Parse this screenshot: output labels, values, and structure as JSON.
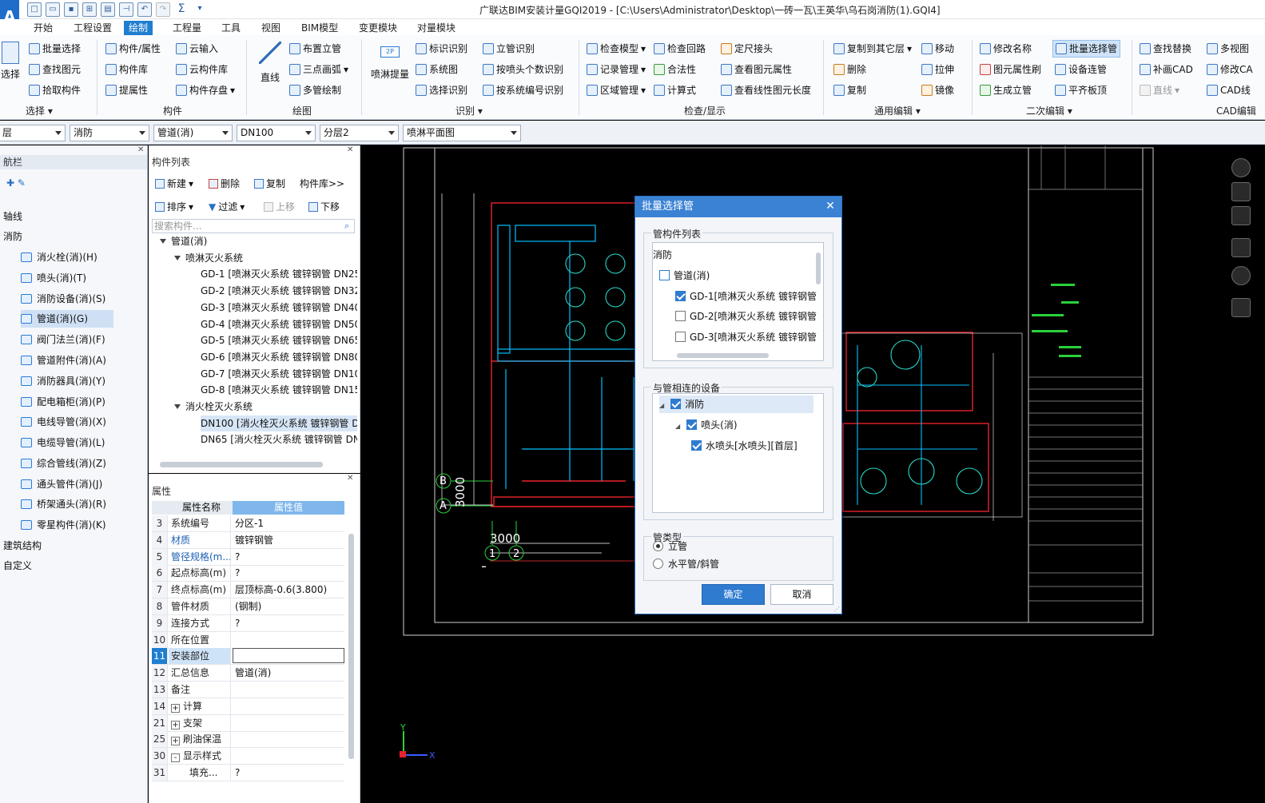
{
  "window": {
    "title": "广联达BIM安装计量GQI2019 - [C:\\Users\\Administrator\\Desktop\\一砖一瓦\\王英华\\乌石岗消防(1).GQI4]",
    "app_icon_letter": "A"
  },
  "quick_access": [
    "new-icon",
    "open-icon",
    "save-icon",
    "export-icon",
    "print-icon",
    "pin-icon",
    "undo-icon",
    "redo-icon",
    "sum-icon",
    "more-icon"
  ],
  "menu": [
    "开始",
    "工程设置",
    "绘制",
    "工程量",
    "工具",
    "视图",
    "BIM模型",
    "变更模块",
    "对量模块"
  ],
  "menu_active": "绘制",
  "ribbon": {
    "select": {
      "big_label": "选择",
      "items": [
        "批量选择",
        "查找图元",
        "拾取构件"
      ],
      "group": "选择"
    },
    "component": {
      "items": [
        "构件/属性",
        "构件库",
        "提属性",
        "云输入",
        "云构件库",
        "构件存盘"
      ],
      "group": "构件"
    },
    "draw": {
      "big_label": "直线",
      "items": [
        "布置立管",
        "三点画弧",
        "多管绘制"
      ],
      "group": "绘图"
    },
    "recognize": {
      "big_label": "喷淋提量",
      "items": [
        "标识识别",
        "系统图",
        "选择识别",
        "立管识别",
        "按喷头个数识别",
        "按系统编号识别"
      ],
      "group": "识别"
    },
    "check": {
      "items": [
        "检查模型",
        "记录管理",
        "区域管理",
        "检查回路",
        "合法性",
        "计算式",
        "定尺接头",
        "查看图元属性",
        "查看线性图元长度"
      ],
      "group": "检查/显示"
    },
    "edit": {
      "items": [
        "复制到其它层",
        "删除",
        "复制",
        "移动",
        "拉伸",
        "镜像"
      ],
      "group": "通用编辑"
    },
    "secondary": {
      "items": [
        "修改名称",
        "图元属性刷",
        "生成立管",
        "批量选择管",
        "设备连管",
        "平齐板顶"
      ],
      "group": "二次编辑"
    },
    "cad": {
      "items": [
        "查找替换",
        "补画CAD",
        "直线",
        "多视图",
        "修改CA",
        "CAD线"
      ],
      "group": "CAD编辑"
    }
  },
  "dropdowns": [
    "层",
    "消防",
    "管道(消)",
    "DN100",
    "分层2",
    "喷淋平面图"
  ],
  "nav": {
    "title": "航栏",
    "items": [
      "轴线",
      "消防",
      "消火栓(消)(H)",
      "喷头(消)(T)",
      "消防设备(消)(S)",
      "管道(消)(G)",
      "阀门法兰(消)(F)",
      "管道附件(消)(A)",
      "消防器具(消)(Y)",
      "配电箱柜(消)(P)",
      "电线导管(消)(X)",
      "电缆导管(消)(L)",
      "综合管线(消)(Z)",
      "通头管件(消)(J)",
      "桥架通头(消)(R)",
      "零星构件(消)(K)",
      "建筑结构",
      "自定义"
    ],
    "selected": "管道(消)(G)"
  },
  "component_list": {
    "title": "构件列表",
    "toolbar": [
      "新建",
      "删除",
      "复制",
      "构件库>>",
      "排序",
      "过滤",
      "上移",
      "下移"
    ],
    "search_placeholder": "搜索构件...",
    "tree": [
      {
        "label": "管道(消)",
        "level": 0
      },
      {
        "label": "喷淋灭火系统",
        "level": 1
      },
      {
        "label": "GD-1 [喷淋灭火系统 镀锌钢管 DN25",
        "level": 2
      },
      {
        "label": "GD-2 [喷淋灭火系统 镀锌钢管 DN32",
        "level": 2
      },
      {
        "label": "GD-3 [喷淋灭火系统 镀锌钢管 DN40",
        "level": 2
      },
      {
        "label": "GD-4 [喷淋灭火系统 镀锌钢管 DN50",
        "level": 2
      },
      {
        "label": "GD-5 [喷淋灭火系统 镀锌钢管 DN65",
        "level": 2
      },
      {
        "label": "GD-6 [喷淋灭火系统 镀锌钢管 DN80",
        "level": 2
      },
      {
        "label": "GD-7 [喷淋灭火系统 镀锌钢管 DN10",
        "level": 2
      },
      {
        "label": "GD-8 [喷淋灭火系统 镀锌钢管 DN15",
        "level": 2
      },
      {
        "label": "消火栓灭火系统",
        "level": 1
      },
      {
        "label": "DN100 [消火栓灭火系统 镀锌钢管 D",
        "level": 2
      },
      {
        "label": "DN65 [消火栓灭火系统 镀锌钢管 DN",
        "level": 2
      }
    ],
    "selected_index": 11
  },
  "properties": {
    "title": "属性",
    "col_name": "属性名称",
    "col_value": "属性值",
    "rows": [
      {
        "n": "3",
        "k": "系统编号",
        "v": "分区-1",
        "blue": false
      },
      {
        "n": "4",
        "k": "材质",
        "v": "镀锌钢管",
        "blue": true
      },
      {
        "n": "5",
        "k": "管径规格(m...",
        "v": "?",
        "blue": true
      },
      {
        "n": "6",
        "k": "起点标高(m)",
        "v": "?",
        "blue": false
      },
      {
        "n": "7",
        "k": "终点标高(m)",
        "v": "层顶标高-0.6(3.800)",
        "blue": false
      },
      {
        "n": "8",
        "k": "管件材质",
        "v": "(钢制)",
        "blue": false
      },
      {
        "n": "9",
        "k": "连接方式",
        "v": "?",
        "blue": false
      },
      {
        "n": "10",
        "k": "所在位置",
        "v": "",
        "blue": false
      },
      {
        "n": "11",
        "k": "安装部位",
        "v": "",
        "blue": false
      },
      {
        "n": "12",
        "k": "汇总信息",
        "v": "管道(消)",
        "blue": false
      },
      {
        "n": "13",
        "k": "备注",
        "v": "",
        "blue": false
      },
      {
        "n": "14",
        "k": "计算",
        "v": "",
        "blue": false,
        "toggle": "+"
      },
      {
        "n": "21",
        "k": "支架",
        "v": "",
        "blue": false,
        "toggle": "+"
      },
      {
        "n": "25",
        "k": "刷油保温",
        "v": "",
        "blue": false,
        "toggle": "+"
      },
      {
        "n": "30",
        "k": "显示样式",
        "v": "",
        "blue": false,
        "toggle": "-"
      },
      {
        "n": "31",
        "k": "填充...",
        "v": "?",
        "blue": false,
        "indent": true
      }
    ],
    "highlight_row": "11"
  },
  "drawing": {
    "grid_labels": [
      "B",
      "A",
      "3000",
      "3000",
      "1",
      "2"
    ],
    "axis_x": "X",
    "axis_y": "Y"
  },
  "dialog": {
    "title": "批量选择管",
    "pipe_list_title": "管构件列表",
    "pipe_tree": [
      {
        "label": "消防",
        "checked": false,
        "level": 0,
        "partial": true
      },
      {
        "label": "管道(消)",
        "checked": false,
        "level": 1,
        "partial": true
      },
      {
        "label": "GD-1[喷淋灭火系统 镀锌钢管",
        "checked": true,
        "level": 2
      },
      {
        "label": "GD-2[喷淋灭火系统 镀锌钢管",
        "checked": false,
        "level": 2
      },
      {
        "label": "GD-3[喷淋灭火系统 镀锌钢管",
        "checked": false,
        "level": 2
      }
    ],
    "device_title": "与管相连的设备",
    "device_tree": [
      {
        "label": "消防",
        "checked": true,
        "level": 0
      },
      {
        "label": "喷头(消)",
        "checked": true,
        "level": 1
      },
      {
        "label": "水喷头[水喷头][首层]",
        "checked": true,
        "level": 2
      }
    ],
    "pipe_type_title": "管类型",
    "pipe_types": [
      "立管",
      "水平管/斜管"
    ],
    "pipe_type_selected": "立管",
    "ok": "确定",
    "cancel": "取消"
  }
}
